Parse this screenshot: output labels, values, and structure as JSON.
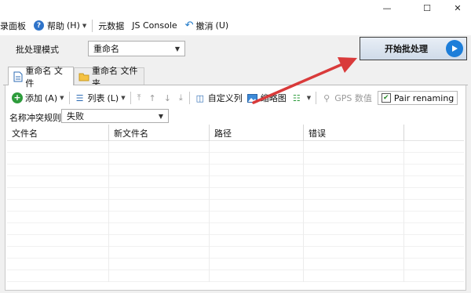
{
  "window": {
    "minimize_glyph": "—",
    "maximize_glyph": "☐",
    "close_glyph": "✕"
  },
  "menubar": {
    "panel_label": "录面板",
    "help_label": "帮助",
    "help_shortcut": "(H)",
    "metadata_label": "元数据",
    "jsconsole_label": "JS Console",
    "undo_label": "撤消",
    "undo_shortcut": "(U)"
  },
  "batch": {
    "mode_label": "批处理模式",
    "mode_value": "重命名",
    "start_label": "开始批处理"
  },
  "tabs": [
    {
      "label": "重命名 文件",
      "icon": "rename-file-icon",
      "active": true
    },
    {
      "label": "重命名 文件夹",
      "icon": "folder-icon",
      "active": false
    }
  ],
  "toolbar": {
    "add_label": "添加",
    "add_shortcut": "(A)",
    "list_label": "列表",
    "list_shortcut": "(L)",
    "custom_columns_label": "自定义列",
    "thumbnail_label": "缩略图",
    "gps_label": "GPS 数值",
    "pair_label": "Pair renaming",
    "pair_checked": true
  },
  "conflict": {
    "label": "名称冲突规则:",
    "value": "失败"
  },
  "table": {
    "columns": [
      "文件名",
      "新文件名",
      "路径",
      "错误",
      ""
    ]
  },
  "colors": {
    "accent": "#1d7ed9",
    "annotation_arrow": "#d93a3a"
  }
}
